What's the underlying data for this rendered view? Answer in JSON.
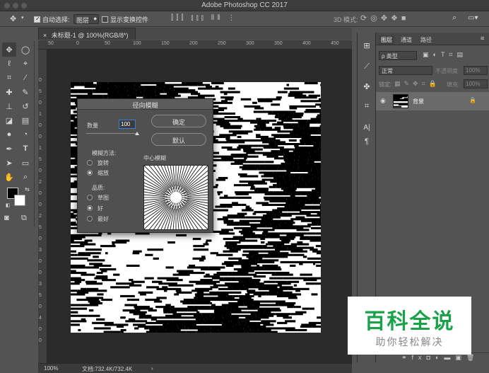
{
  "app": {
    "title": "Adobe Photoshop CC 2017"
  },
  "options": {
    "auto_select_label": "自动选择:",
    "auto_select_value": "图层",
    "show_transform_label": "显示变换控件",
    "mode_3d_label": "3D 模式:"
  },
  "document": {
    "tab_title": "未标题-1 @ 100%(RGB/8*) *",
    "tab_close": "×",
    "ruler_top": [
      "50",
      "0",
      "50",
      "100",
      "150",
      "200",
      "250",
      "300",
      "350",
      "400",
      "450"
    ],
    "ruler_left": [
      "0",
      "5",
      "0",
      "1",
      "0",
      "0",
      "1",
      "5",
      "0",
      "2",
      "0",
      "0",
      "2",
      "5",
      "0",
      "3",
      "0",
      "0",
      "3",
      "5",
      "0",
      "4",
      "0",
      "0"
    ]
  },
  "dialog": {
    "title": "径向模糊",
    "amount_label": "数量",
    "amount_value": "100",
    "ok_label": "确定",
    "default_label": "默认",
    "method_label": "模糊方法:",
    "method_spin": "旋转",
    "method_zoom": "缩放",
    "quality_label": "品质:",
    "quality_draft": "草图",
    "quality_good": "好",
    "quality_best": "最好",
    "center_label": "中心模糊",
    "selected_method": "zoom",
    "selected_quality": "good",
    "amount_fraction": 1.0
  },
  "layers_panel": {
    "tabs": [
      "图层",
      "通道",
      "路径"
    ],
    "filter_label": "ρ 类型",
    "blend_mode": "正常",
    "opacity_label": "不透明度:",
    "opacity_value": "100%",
    "lock_label": "锁定:",
    "fill_label": "填充:",
    "fill_value": "100%",
    "layer_name": "背景"
  },
  "status": {
    "zoom": "100%",
    "doc_info": "文档:732.4K/732.4K"
  },
  "watermark": {
    "main": "百科全说",
    "sub": "助你轻松解决"
  },
  "colors": {
    "accent_green": "#1aa24a",
    "ui_dark": "#535353",
    "canvas_bg": "#2b2b2b"
  }
}
